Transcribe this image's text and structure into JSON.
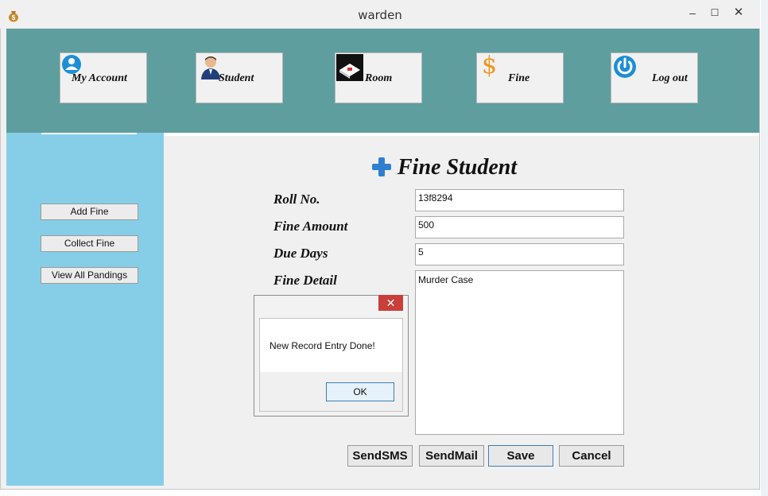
{
  "window": {
    "title": "warden",
    "minimize": "–",
    "maximize": "☐",
    "close": "✕"
  },
  "nav": {
    "my_account": "My Account",
    "student": "Student",
    "room": "Room",
    "fine": "Fine",
    "logout": "Log out"
  },
  "sidebar": {
    "add_fine": "Add Fine",
    "collect_fine": "Collect Fine",
    "view_pendings": "View All Pandings"
  },
  "form": {
    "title": "Fine Student",
    "roll_no_label": "Roll No.",
    "roll_no_value": "13f8294",
    "fine_amount_label": "Fine Amount",
    "fine_amount_value": "500",
    "due_days_label": "Due Days",
    "due_days_value": "5",
    "fine_detail_label": "Fine Detail",
    "fine_detail_value": "Murder Case"
  },
  "actions": {
    "send_sms": "SendSMS",
    "send_mail": "SendMail",
    "save": "Save",
    "cancel": "Cancel"
  },
  "dialog": {
    "message": "New Record Entry Done!",
    "ok": "OK",
    "close": "✕"
  },
  "colors": {
    "banner": "#5f9e9e",
    "sidebar": "#86cee8",
    "dialog_close": "#c9403a",
    "accent_blue": "#1e7fd6"
  }
}
